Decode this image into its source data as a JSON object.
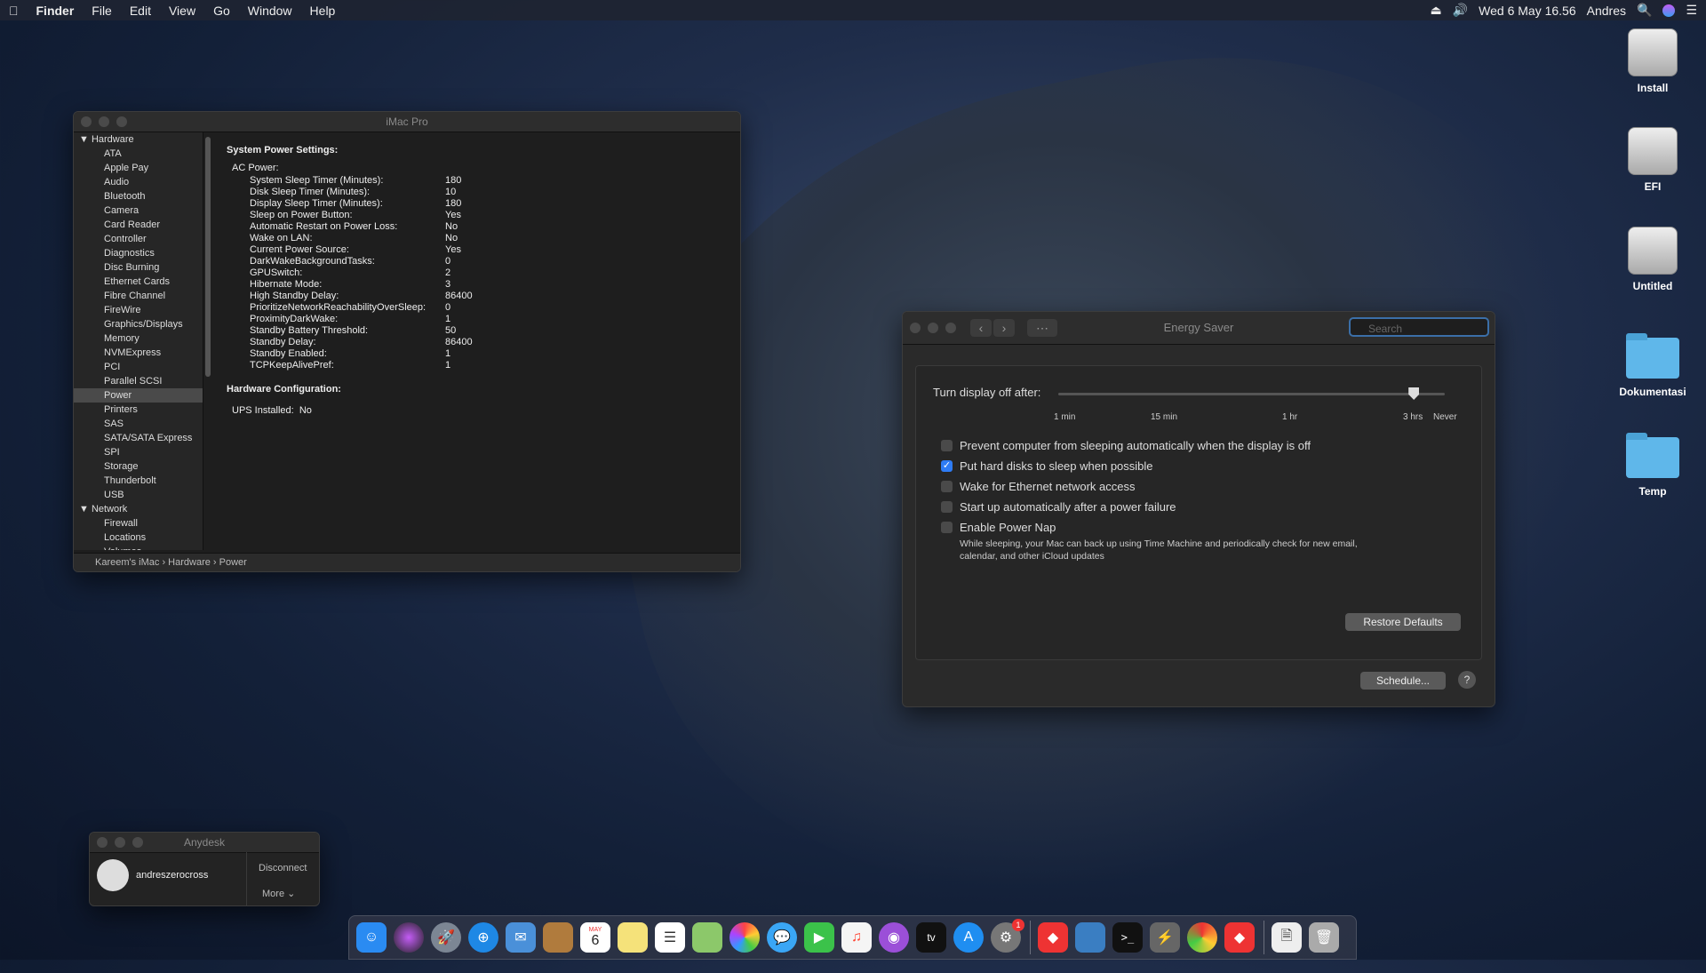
{
  "menubar": {
    "apple": "",
    "app": "Finder",
    "menus": [
      "File",
      "Edit",
      "View",
      "Go",
      "Window",
      "Help"
    ],
    "datetime": "Wed 6 May  16.56",
    "user": "Andres",
    "search_icon": "🔍",
    "volume_icon": "🔊",
    "eject_icon": "⏏"
  },
  "sysinfo": {
    "title": "iMac Pro",
    "sidebar": {
      "hardware": "Hardware",
      "hardware_items": [
        "ATA",
        "Apple Pay",
        "Audio",
        "Bluetooth",
        "Camera",
        "Card Reader",
        "Controller",
        "Diagnostics",
        "Disc Burning",
        "Ethernet Cards",
        "Fibre Channel",
        "FireWire",
        "Graphics/Displays",
        "Memory",
        "NVMExpress",
        "PCI",
        "Parallel SCSI",
        "Power",
        "Printers",
        "SAS",
        "SATA/SATA Express",
        "SPI",
        "Storage",
        "Thunderbolt",
        "USB"
      ],
      "network": "Network",
      "network_items": [
        "Firewall",
        "Locations",
        "Volumes"
      ]
    },
    "detail": {
      "heading1": "System Power Settings:",
      "ac_power": "AC Power:",
      "rows": [
        [
          "System Sleep Timer (Minutes):",
          "180"
        ],
        [
          "Disk Sleep Timer (Minutes):",
          "10"
        ],
        [
          "Display Sleep Timer (Minutes):",
          "180"
        ],
        [
          "Sleep on Power Button:",
          "Yes"
        ],
        [
          "Automatic Restart on Power Loss:",
          "No"
        ],
        [
          "Wake on LAN:",
          "No"
        ],
        [
          "Current Power Source:",
          "Yes"
        ],
        [
          "DarkWakeBackgroundTasks:",
          "0"
        ],
        [
          "GPUSwitch:",
          "2"
        ],
        [
          "Hibernate Mode:",
          "3"
        ],
        [
          "High Standby Delay:",
          "86400"
        ],
        [
          "PrioritizeNetworkReachabilityOverSleep:",
          "0"
        ],
        [
          "ProximityDarkWake:",
          "1"
        ],
        [
          "Standby Battery Threshold:",
          "50"
        ],
        [
          "Standby Delay:",
          "86400"
        ],
        [
          "Standby Enabled:",
          "1"
        ],
        [
          "TCPKeepAlivePref:",
          "1"
        ]
      ],
      "heading2": "Hardware Configuration:",
      "ups_label": "UPS Installed:",
      "ups_value": "No"
    },
    "pathbar": "Kareem's iMac  ›  Hardware  ›  Power"
  },
  "energy": {
    "title": "Energy Saver",
    "search_placeholder": "Search",
    "slider_label": "Turn display off after:",
    "slider_level": 0.92,
    "ticks": [
      "1 min",
      "15 min",
      "1 hr",
      "3 hrs",
      "Never"
    ],
    "options": [
      {
        "label": "Prevent computer from sleeping automatically when the display is off",
        "checked": false
      },
      {
        "label": "Put hard disks to sleep when possible",
        "checked": true
      },
      {
        "label": "Wake for Ethernet network access",
        "checked": false
      },
      {
        "label": "Start up automatically after a power failure",
        "checked": false
      },
      {
        "label": "Enable Power Nap",
        "checked": false
      }
    ],
    "powernap_desc_1": "While sleeping, your Mac can back up using Time Machine and periodically check for new email,",
    "powernap_desc_2": "calendar, and other iCloud updates",
    "restore_button": "Restore Defaults",
    "schedule_button": "Schedule...",
    "help": "?"
  },
  "anydesk": {
    "title": "Anydesk",
    "user": "andreszerocross",
    "disconnect": "Disconnect",
    "more": "More"
  },
  "desktop": {
    "icons": [
      "Install",
      "EFI",
      "Untitled",
      "Dokumentasi",
      "Temp"
    ]
  },
  "dock": {
    "calendar_month": "MAY",
    "calendar_day": "6",
    "appletv": "tv",
    "badge": "1"
  }
}
